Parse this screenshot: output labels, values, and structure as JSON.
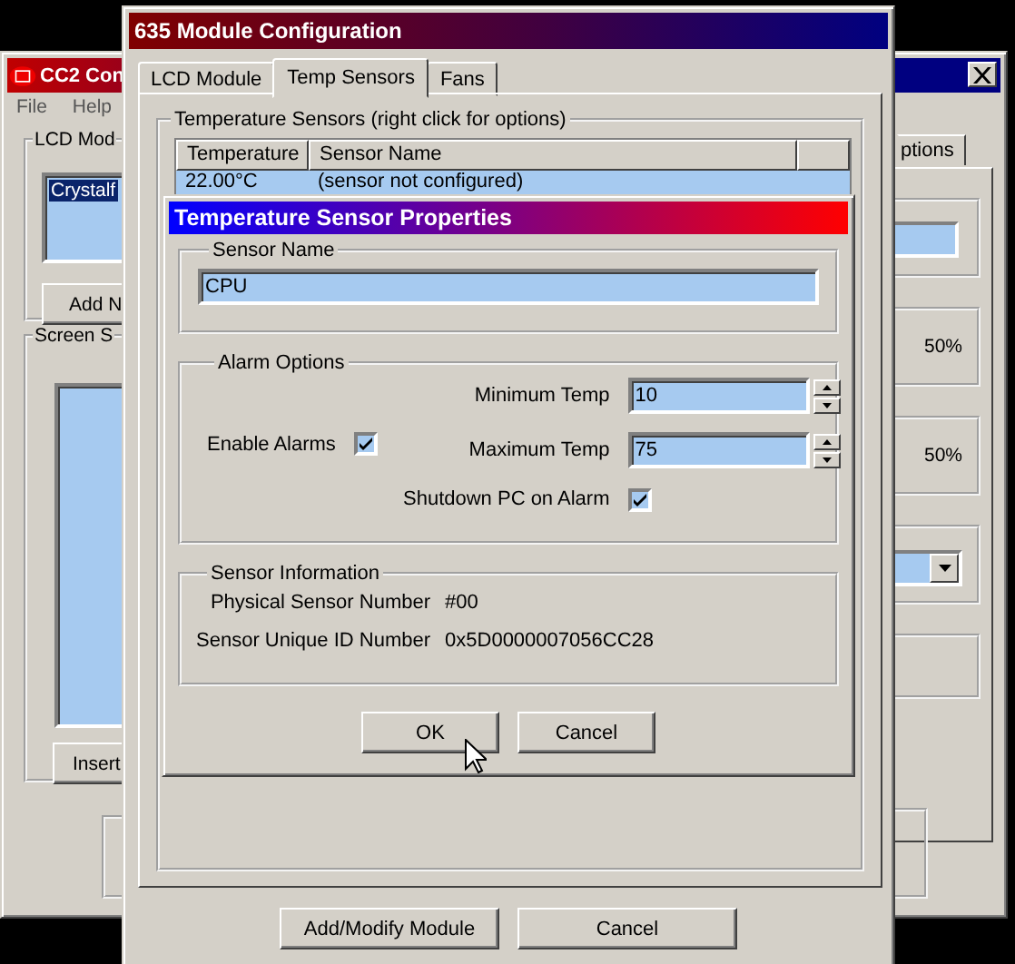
{
  "back_window": {
    "title": "CC2 Con",
    "menu": [
      {
        "label": "File"
      },
      {
        "label": "Help"
      }
    ],
    "lcd_group": {
      "label": "LCD Mod",
      "items": [
        {
          "label": "Crystalf",
          "selected": true
        }
      ],
      "button": "Add N"
    },
    "screen_group": {
      "label": "Screen S",
      "button": "Insert"
    },
    "tab": "ptions",
    "readings": [
      "50%",
      "50%"
    ]
  },
  "module_window": {
    "title": "635 Module Configuration",
    "tabs": [
      {
        "label": "LCD Module",
        "selected": false
      },
      {
        "label": "Temp Sensors",
        "selected": true
      },
      {
        "label": "Fans",
        "selected": false
      }
    ],
    "group": "Temperature Sensors (right click for options)",
    "table": {
      "columns": [
        "Temperature",
        "Sensor Name"
      ],
      "rows": [
        [
          "22.00°C",
          "(sensor not configured)"
        ]
      ]
    },
    "buttons": [
      "Add/Modify Module",
      "Cancel"
    ]
  },
  "dialog": {
    "title": "Temperature Sensor Properties",
    "sensor_name": {
      "label": "Sensor Name",
      "value": "CPU"
    },
    "alarm": {
      "label": "Alarm Options",
      "enable": {
        "label": "Enable Alarms",
        "checked": true
      },
      "min": {
        "label": "Minimum Temp",
        "value": "10"
      },
      "max": {
        "label": "Maximum Temp",
        "value": "75"
      },
      "shutdown": {
        "label": "Shutdown PC on Alarm",
        "checked": true
      }
    },
    "info": {
      "label": "Sensor Information",
      "rows": [
        {
          "label": "Physical Sensor Number",
          "value": "#00"
        },
        {
          "label": "Sensor Unique ID Number",
          "value": "0x5D0000007056CC28"
        }
      ]
    },
    "buttons": [
      "OK",
      "Cancel"
    ]
  }
}
